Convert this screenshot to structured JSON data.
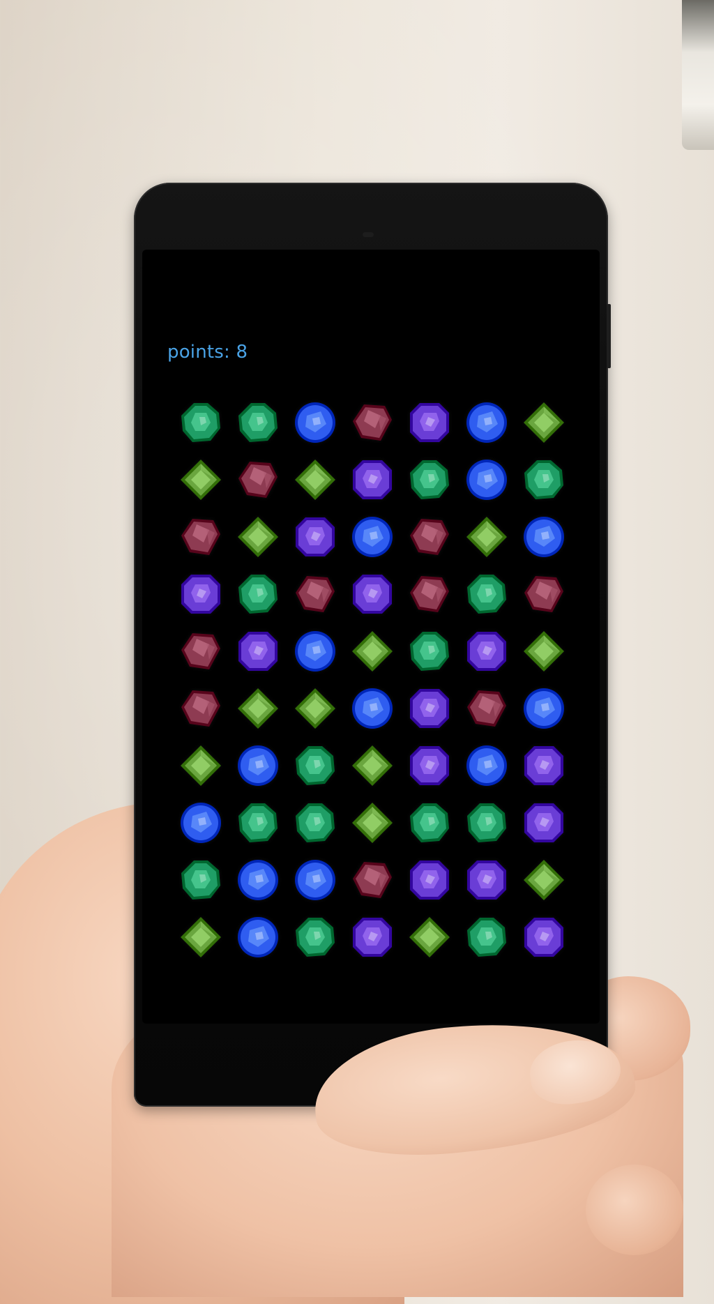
{
  "game": {
    "points_label": "points: 8"
  },
  "board": {
    "rows": [
      [
        "emerald",
        "emerald",
        "sapphire",
        "ruby",
        "amethyst",
        "sapphire",
        "peridot"
      ],
      [
        "peridot",
        "ruby",
        "peridot",
        "amethyst",
        "emerald",
        "sapphire",
        "emerald"
      ],
      [
        "ruby",
        "peridot",
        "amethyst",
        "sapphire",
        "ruby",
        "peridot",
        "sapphire"
      ],
      [
        "amethyst",
        "emerald",
        "ruby",
        "amethyst",
        "ruby",
        "emerald",
        "ruby"
      ],
      [
        "ruby",
        "amethyst",
        "sapphire",
        "peridot",
        "emerald",
        "amethyst",
        "peridot"
      ],
      [
        "ruby",
        "peridot",
        "peridot",
        "sapphire",
        "amethyst",
        "ruby",
        "sapphire"
      ],
      [
        "peridot",
        "sapphire",
        "emerald",
        "peridot",
        "amethyst",
        "sapphire",
        "amethyst"
      ],
      [
        "sapphire",
        "emerald",
        "emerald",
        "peridot",
        "emerald",
        "emerald",
        "amethyst"
      ],
      [
        "emerald",
        "sapphire",
        "sapphire",
        "ruby",
        "amethyst",
        "amethyst",
        "peridot"
      ],
      [
        "peridot",
        "sapphire",
        "emerald",
        "amethyst",
        "peridot",
        "emerald",
        "amethyst"
      ]
    ]
  },
  "gem_types": {
    "emerald": {
      "icon": "emerald-gem-icon",
      "color": "#1f9e66"
    },
    "sapphire": {
      "icon": "sapphire-gem-icon",
      "color": "#2f5df0"
    },
    "ruby": {
      "icon": "ruby-gem-icon",
      "color": "#8e3b52"
    },
    "amethyst": {
      "icon": "amethyst-gem-icon",
      "color": "#6a3dd6"
    },
    "peridot": {
      "icon": "peridot-gem-icon",
      "color": "#6aa63f"
    }
  }
}
